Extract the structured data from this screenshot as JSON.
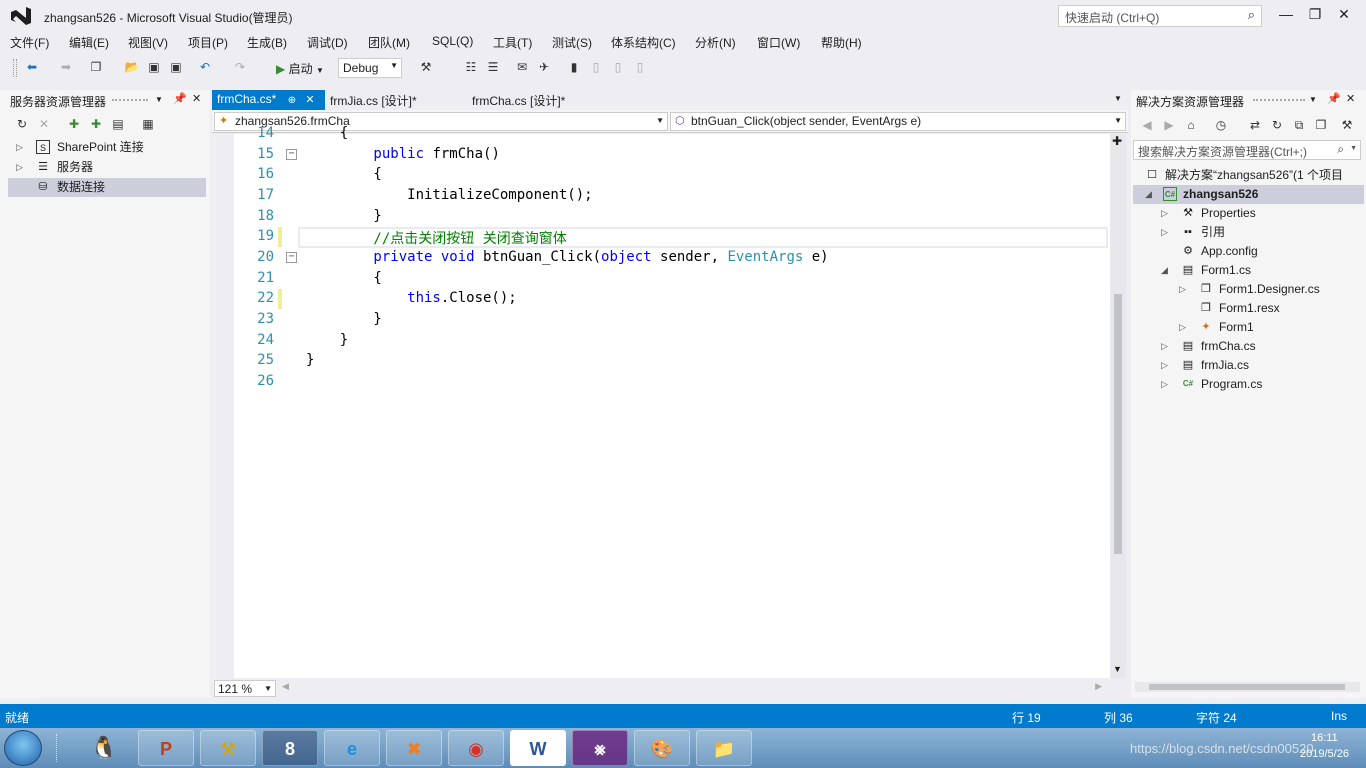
{
  "window": {
    "title": "zhangsan526 - Microsoft Visual Studio(管理员)",
    "quick_launch_placeholder": "快速启动 (Ctrl+Q)"
  },
  "menu": [
    "文件(F)",
    "编辑(E)",
    "视图(V)",
    "项目(P)",
    "生成(B)",
    "调试(D)",
    "团队(M)",
    "SQL(Q)",
    "工具(T)",
    "测试(S)",
    "体系结构(C)",
    "分析(N)",
    "窗口(W)",
    "帮助(H)"
  ],
  "toolbar": {
    "start_label": "启动",
    "config_value": "Debug"
  },
  "server_explorer": {
    "title": "服务器资源管理器",
    "items": [
      {
        "label": "SharePoint 连接",
        "selected": false
      },
      {
        "label": "服务器",
        "selected": false
      },
      {
        "label": "数据连接",
        "selected": true
      }
    ]
  },
  "tabs": [
    {
      "label": "frmCha.cs*",
      "active": true
    },
    {
      "label": "frmJia.cs [设计]*",
      "active": false
    },
    {
      "label": "frmCha.cs [设计]*",
      "active": false
    }
  ],
  "nav": {
    "class_combo": "zhangsan526.frmCha",
    "member_combo": "btnGuan_Click(object sender, EventArgs e)"
  },
  "code_lines": [
    {
      "num": "14",
      "text": "    {"
    },
    {
      "num": "15",
      "text": "        public frmCha()"
    },
    {
      "num": "16",
      "text": "        {"
    },
    {
      "num": "17",
      "text": "            InitializeComponent();"
    },
    {
      "num": "18",
      "text": "        }"
    },
    {
      "num": "19",
      "text": "        //点击关闭按钮 关闭查询窗体"
    },
    {
      "num": "20",
      "text": "        private void btnGuan_Click(object sender, EventArgs e)"
    },
    {
      "num": "21",
      "text": "        {"
    },
    {
      "num": "22",
      "text": "            this.Close();"
    },
    {
      "num": "23",
      "text": "        }"
    },
    {
      "num": "24",
      "text": "    }"
    },
    {
      "num": "25",
      "text": "}"
    },
    {
      "num": "26",
      "text": ""
    }
  ],
  "zoom_level": "121 %",
  "solution_explorer": {
    "title": "解决方案资源管理器",
    "search_placeholder": "搜索解决方案资源管理器(Ctrl+;)",
    "solution_label": "解决方案“zhangsan526”(1 个项目",
    "project_label": "zhangsan526",
    "items": [
      {
        "label": "Properties",
        "depth": 1,
        "caret": "closed"
      },
      {
        "label": "引用",
        "depth": 1,
        "caret": "closed"
      },
      {
        "label": "App.config",
        "depth": 1,
        "caret": "none"
      },
      {
        "label": "Form1.cs",
        "depth": 1,
        "caret": "open"
      },
      {
        "label": "Form1.Designer.cs",
        "depth": 2,
        "caret": "closed"
      },
      {
        "label": "Form1.resx",
        "depth": 2,
        "caret": "none"
      },
      {
        "label": "Form1",
        "depth": 2,
        "caret": "closed"
      },
      {
        "label": "frmCha.cs",
        "depth": 1,
        "caret": "closed"
      },
      {
        "label": "frmJia.cs",
        "depth": 1,
        "caret": "closed"
      },
      {
        "label": "Program.cs",
        "depth": 1,
        "caret": "closed"
      }
    ]
  },
  "status": {
    "ready": "就绪",
    "line": "行 19",
    "col": "列 36",
    "char": "字符 24",
    "mode": "Ins"
  },
  "taskbar": {
    "clock_time": "16:11",
    "clock_date": "2019/5/26",
    "watermark": "https://blog.csdn.net/csdn00520"
  },
  "colors": {
    "accent": "#007acc",
    "keyword": "#0000ff",
    "type": "#2b91af",
    "comment": "#008000",
    "line_number": "#2b91af"
  }
}
